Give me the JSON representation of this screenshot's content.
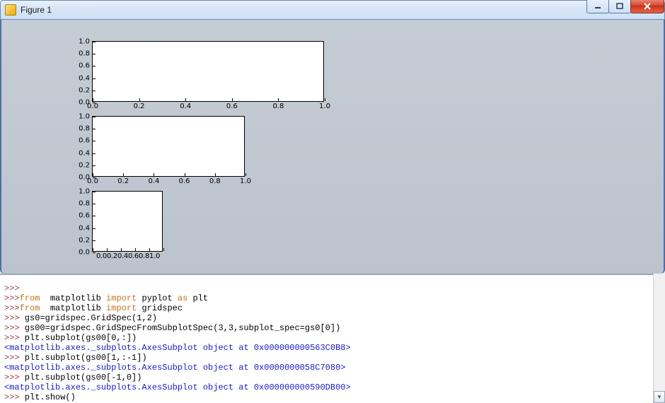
{
  "window": {
    "title": "Figure 1"
  },
  "chart_data": [
    {
      "type": "blank-axes",
      "title": "",
      "xlabel": "",
      "ylabel": "",
      "xlim": [
        0.0,
        1.0
      ],
      "ylim": [
        0.0,
        1.0
      ],
      "xticks": [
        0.0,
        0.2,
        0.4,
        0.6,
        0.8,
        1.0
      ],
      "yticks": [
        0.0,
        0.2,
        0.4,
        0.6,
        0.8,
        1.0
      ],
      "series": []
    },
    {
      "type": "blank-axes",
      "title": "",
      "xlabel": "",
      "ylabel": "",
      "xlim": [
        0.0,
        1.0
      ],
      "ylim": [
        0.0,
        1.0
      ],
      "xticks": [
        0.0,
        0.2,
        0.4,
        0.6,
        0.8,
        1.0
      ],
      "yticks": [
        0.0,
        0.2,
        0.4,
        0.6,
        0.8,
        1.0
      ],
      "series": []
    },
    {
      "type": "blank-axes",
      "title": "",
      "xlabel": "",
      "ylabel": "",
      "xlim": [
        0.0,
        1.0
      ],
      "ylim": [
        0.0,
        1.0
      ],
      "xticks": [
        0.0,
        0.2,
        0.4,
        0.6,
        0.8,
        1.0
      ],
      "xtick_labels": [
        "0.0",
        "0.2",
        "0.4",
        "0.6",
        "0.8",
        "1.0"
      ],
      "yticks": [
        0.0,
        0.2,
        0.4,
        0.6,
        0.8,
        1.0
      ],
      "series": []
    }
  ],
  "console": {
    "lines": [
      {
        "prompt": ">>>",
        "code": ""
      },
      {
        "prompt": ">>>",
        "code_parts": [
          [
            "kw",
            "from"
          ],
          [
            "",
            "  matplotlib "
          ],
          [
            "kw",
            "import"
          ],
          [
            "",
            " pyplot "
          ],
          [
            "kw",
            "as"
          ],
          [
            "",
            " plt"
          ]
        ]
      },
      {
        "prompt": ">>>",
        "code_parts": [
          [
            "kw",
            "from"
          ],
          [
            "",
            "  matplotlib "
          ],
          [
            "kw",
            "import"
          ],
          [
            "",
            " gridspec"
          ]
        ]
      },
      {
        "prompt": ">>>",
        "code": " gs0=gridspec.GridSpec(1,2)"
      },
      {
        "prompt": ">>>",
        "code": " gs00=gridspec.GridSpecFromSubplotSpec(3,3,subplot_spec=gs0[0])"
      },
      {
        "prompt": ">>>",
        "code": " plt.subplot(gs00[0,:])"
      },
      {
        "out": "<matplotlib.axes._subplots.AxesSubplot object at 0x000000000563C0B8>"
      },
      {
        "prompt": ">>>",
        "code": " plt.subplot(gs00[1,:-1])"
      },
      {
        "out": "<matplotlib.axes._subplots.AxesSubplot object at 0x0000000058C7080>"
      },
      {
        "prompt": ">>>",
        "code": " plt.subplot(gs00[-1,0])"
      },
      {
        "out": "<matplotlib.axes._subplots.AxesSubplot object at 0x000000000590DB00>"
      },
      {
        "prompt": ">>>",
        "code": " plt.show()"
      }
    ]
  },
  "tick_labels": {
    "dec1": [
      "0.0",
      "0.2",
      "0.4",
      "0.6",
      "0.8",
      "1.0"
    ],
    "compact": [
      "0.00.20.40.60.81.0"
    ]
  }
}
